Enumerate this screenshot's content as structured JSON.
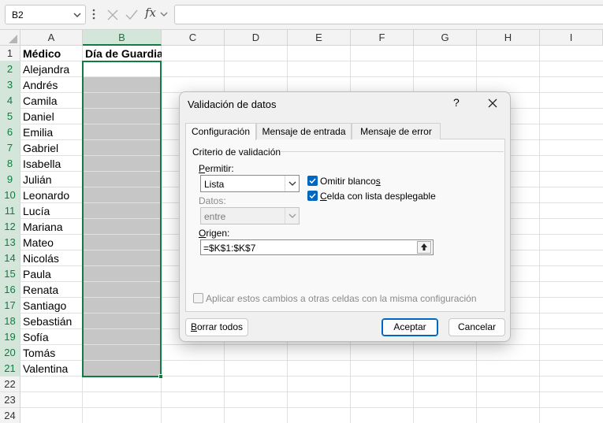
{
  "formula_bar": {
    "name_box": "B2",
    "fx_label": "fx",
    "formula": ""
  },
  "sheet": {
    "columns": [
      "A",
      "B",
      "C",
      "D",
      "E",
      "F",
      "G",
      "H",
      "I"
    ],
    "rows": [
      "1",
      "2",
      "3",
      "4",
      "5",
      "6",
      "7",
      "8",
      "9",
      "10",
      "11",
      "12",
      "13",
      "14",
      "15",
      "16",
      "17",
      "18",
      "19",
      "20",
      "21",
      "22",
      "23",
      "24"
    ],
    "header_a": "Médico",
    "header_b": "Día de Guardia",
    "names": [
      "Alejandra",
      "Andrés",
      "Camila",
      "Daniel",
      "Emilia",
      "Gabriel",
      "Isabella",
      "Julián",
      "Leonardo",
      "Lucía",
      "Mariana",
      "Mateo",
      "Nicolás",
      "Paula",
      "Renata",
      "Santiago",
      "Sebastián",
      "Sofía",
      "Tomás",
      "Valentina"
    ]
  },
  "dialog": {
    "title": "Validación de datos",
    "help": "?",
    "tabs": [
      "Configuración",
      "Mensaje de entrada",
      "Mensaje de error"
    ],
    "group_title": "Criterio de validación",
    "allow_label_u": "P",
    "allow_label_rest": "ermitir:",
    "allow_value": "Lista",
    "data_label": "Datos:",
    "data_value": "entre",
    "ignore_blank_a": "Omitir blanco",
    "ignore_blank_u": "s",
    "incell_u": "C",
    "incell_rest": "elda con lista desplegable",
    "source_label_u": "O",
    "source_label_rest": "rigen:",
    "source_value": "=$K$1:$K$7",
    "apply_all": "Aplicar estos cambios a otras celdas con la misma configuración",
    "clear_all_u": "B",
    "clear_all_rest": "orrar todos",
    "ok": "Aceptar",
    "cancel": "Cancelar"
  },
  "colors": {
    "excel_green": "#107c41",
    "selection_fill": "#c6c6c6",
    "check_blue": "#0067c0"
  }
}
